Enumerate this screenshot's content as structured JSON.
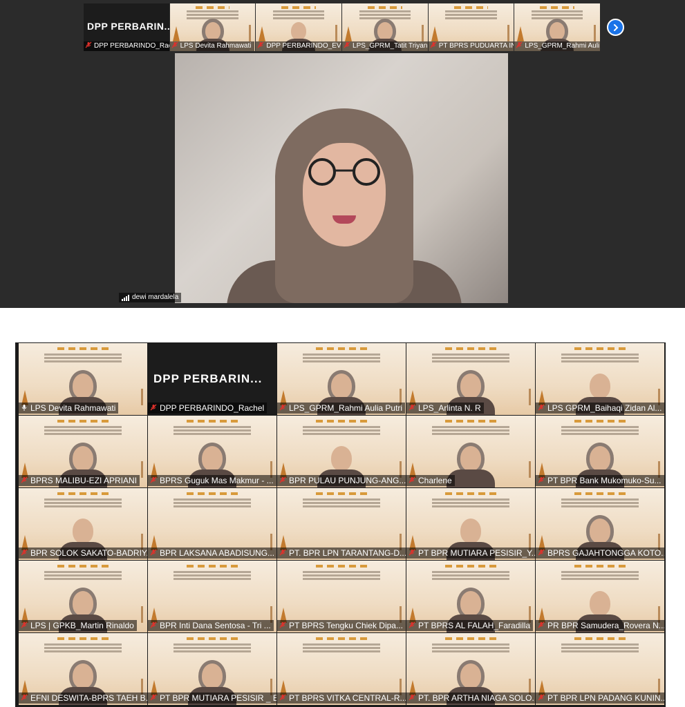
{
  "speaker_view": {
    "strip_tiles": [
      {
        "name": "DPP PERBARINDO_Rac",
        "big_label": "DPP  PERBARIN...",
        "type": "label",
        "mic": "muted"
      },
      {
        "name": "LPS Devita Rahmawati",
        "type": "person",
        "mic": "muted"
      },
      {
        "name": "DPP PERBARINDO_EVI",
        "type": "person",
        "mic": "muted"
      },
      {
        "name": "LPS_GPRM_Tatit Triyan",
        "type": "person",
        "mic": "muted"
      },
      {
        "name": "PT BPRS PUDUARTA IN",
        "type": "logo",
        "mic": "muted"
      },
      {
        "name": "LPS_GPRM_Rahmi Auli",
        "type": "person",
        "mic": "muted"
      }
    ],
    "next_button_icon": "chevron-right-icon",
    "active_speaker": {
      "name": "dewi mardalela",
      "signal_icon": "signal-bars-icon"
    }
  },
  "gallery_view": {
    "tiles": [
      {
        "name": "LPS Devita Rahmawati",
        "active": true,
        "person": true,
        "mic_icon": "mic-active-icon"
      },
      {
        "name": "DPP PERBARINDO_Rachel",
        "big_label": "DPP  PERBARIN...",
        "person": false,
        "mic_icon": "mic-off-icon"
      },
      {
        "name": "LPS_GPRM_Rahmi Aulia Putri",
        "person": true,
        "mic_icon": "mic-off-icon"
      },
      {
        "name": "LPS_Arlinta N. R",
        "person": true,
        "mic_icon": "mic-off-icon"
      },
      {
        "name": "LPS GPRM_Baihaqi Zidan Al...",
        "person": true,
        "mic_icon": "mic-off-icon"
      },
      {
        "name": "BPRS MALIBU-EZI APRIANI",
        "person": true,
        "mic_icon": "mic-off-icon"
      },
      {
        "name": "BPRS Guguk Mas Makmur - ...",
        "person": true,
        "mic_icon": "mic-off-icon"
      },
      {
        "name": "BPR PULAU PUNJUNG-ANG...",
        "person": true,
        "mic_icon": "mic-off-icon"
      },
      {
        "name": "Charlene",
        "person": true,
        "mic_icon": "mic-off-icon"
      },
      {
        "name": "PT BPR Bank Mukomuko-Su...",
        "person": true,
        "mic_icon": "mic-off-icon"
      },
      {
        "name": "BPR SOLOK SAKATO-BADRIY...",
        "person": true,
        "mic_icon": "mic-off-icon"
      },
      {
        "name": "BPR LAKSANA ABADISUNG...",
        "person": false,
        "mic_icon": "mic-off-icon"
      },
      {
        "name": "PT. BPR LPN TARANTANG-D...",
        "person": false,
        "mic_icon": "mic-off-icon"
      },
      {
        "name": "PT BPR MUTIARA PESISIR_Y...",
        "person": true,
        "mic_icon": "mic-off-icon"
      },
      {
        "name": "BPRS GAJAHTONGGA KOTO...",
        "person": true,
        "mic_icon": "mic-off-icon"
      },
      {
        "name": "LPS | GPKB_Martin Rinaldo",
        "person": true,
        "mic_icon": "mic-off-icon"
      },
      {
        "name": "BPR Inti Dana Sentosa - Tri ...",
        "person": false,
        "mic_icon": "mic-off-icon"
      },
      {
        "name": "PT BPRS Tengku Chiek Dipa...",
        "person": false,
        "mic_icon": "mic-off-icon"
      },
      {
        "name": "PT BPRS AL FALAH_Faradilla",
        "person": true,
        "mic_icon": "mic-off-icon"
      },
      {
        "name": "PR BPR Samudera_Rovera N...",
        "person": true,
        "mic_icon": "mic-off-icon"
      },
      {
        "name": "EFNI DESWITA-BPRS TAEH B...",
        "person": true,
        "mic_icon": "mic-off-icon"
      },
      {
        "name": "PT BPR MUTIARA PESISIR _ E...",
        "person": true,
        "mic_icon": "mic-off-icon"
      },
      {
        "name": "PT BPRS VITKA CENTRAL-R...",
        "person": false,
        "mic_icon": "mic-off-icon"
      },
      {
        "name": "PT. BPR ARTHA NIAGA SOLO...",
        "person": true,
        "mic_icon": "mic-off-icon"
      },
      {
        "name": "PT BPR LPN PADANG KUNIN...",
        "person": false,
        "mic_icon": "mic-off-icon"
      }
    ]
  },
  "colors": {
    "panel_bg": "#2b2b2b",
    "active_border": "#2bb673",
    "next_button": "#1a73e8",
    "mic_off": "#e0312b"
  }
}
